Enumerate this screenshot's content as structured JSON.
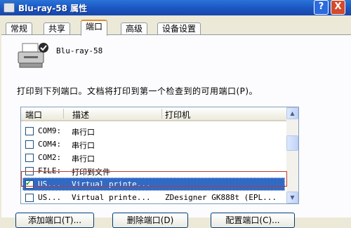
{
  "window": {
    "title": "Blu-ray-58 属性",
    "help_label": "?",
    "close_label": "X"
  },
  "tabs": [
    {
      "label": "常规"
    },
    {
      "label": "共享"
    },
    {
      "label": "端口"
    },
    {
      "label": "高级"
    },
    {
      "label": "设备设置"
    }
  ],
  "printer": {
    "name": "Blu-ray-58"
  },
  "description": "打印到下列端口。文档将打印到第一个检查到的可用端口(P)。",
  "ports_table": {
    "headers": {
      "port": "端口",
      "desc": "描述",
      "printer": "打印机"
    },
    "rows": [
      {
        "port": "COM9:",
        "desc": "串行口",
        "printer": "",
        "checked": false
      },
      {
        "port": "COM4:",
        "desc": "串行口",
        "printer": "",
        "checked": false
      },
      {
        "port": "COM2:",
        "desc": "串行口",
        "printer": "",
        "checked": false
      },
      {
        "port": "FILE:",
        "desc": "打印到文件",
        "printer": "",
        "checked": false
      },
      {
        "port": "US...",
        "desc": "Virtual printe...",
        "printer": "",
        "checked": true
      },
      {
        "port": "US...",
        "desc": "Virtual printe...",
        "printer": "ZDesigner GK888t (EPL...",
        "checked": false
      }
    ]
  },
  "buttons": {
    "add_port": "添加端口(T)...",
    "delete_port": "删除端口(D)",
    "configure_port": "配置端口(C)..."
  },
  "colors": {
    "title_bar": "#1a55c1",
    "selection": "#316ac5",
    "highlight_box": "#c0392b"
  }
}
